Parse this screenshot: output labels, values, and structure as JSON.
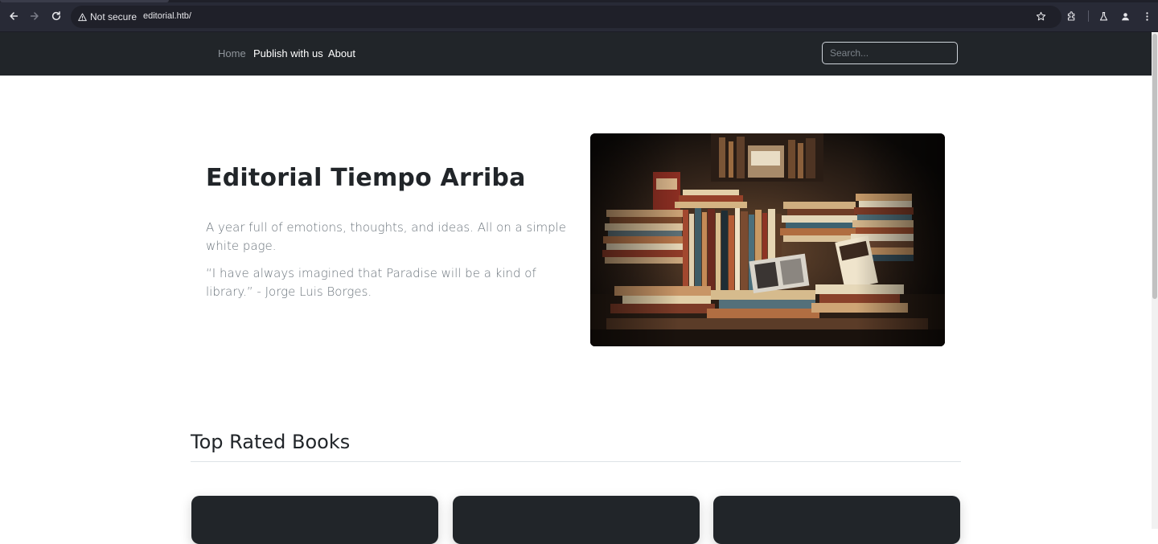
{
  "browser": {
    "security_label": "Not secure",
    "url": "editorial.htb/",
    "icons": [
      "back-arrow-icon",
      "forward-arrow-icon",
      "reload-icon",
      "warning-icon",
      "star-icon",
      "extensions-icon",
      "labs-flask-icon",
      "profile-icon",
      "kebab-menu-icon"
    ]
  },
  "navbar": {
    "links": [
      {
        "label": "Home",
        "state": "muted"
      },
      {
        "label": "Publish with us",
        "state": "active"
      },
      {
        "label": "About",
        "state": "active"
      }
    ],
    "search": {
      "placeholder": "Search...",
      "value": ""
    }
  },
  "hero": {
    "title": "Editorial Tiempo Arriba",
    "lead": "A year full of emotions, thoughts, and ideas. All on a simple white page.",
    "quote": "“I have always imagined that Paradise will be a kind of library.” - Jorge Luis Borges.",
    "image_subject": "stacks of books in a library"
  },
  "top_rated": {
    "title": "Top Rated Books",
    "cards": 3
  },
  "colors": {
    "chrome_bg": "#282a36",
    "navbar_bg": "#212529",
    "muted_link": "#8f959b",
    "heading": "#212529",
    "body_text": "#6c757d",
    "card_bg": "#212529"
  }
}
